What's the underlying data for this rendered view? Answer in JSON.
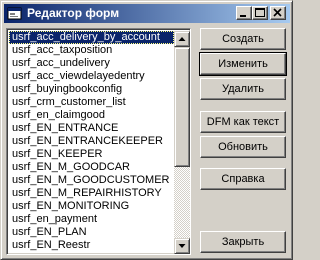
{
  "window": {
    "title": "Редактор форм"
  },
  "list": {
    "items": [
      "usrf_acc_delivery_by_account",
      "usrf_acc_taxposition",
      "usrf_acc_undelivery",
      "usrf_acc_viewdelayedentry",
      "usrf_buyingbookconfig",
      "usrf_crm_customer_list",
      "usrf_en_claimgood",
      "usrf_EN_ENTRANCE",
      "usrf_EN_ENTRANCEKEEPER",
      "usrf_EN_KEEPER",
      "usrf_EN_M_GOODCAR",
      "usrf_EN_M_GOODCUSTOMER",
      "usrf_EN_M_REPAIRHISTORY",
      "usrf_EN_MONITORING",
      "usrf_en_payment",
      "usrf_EN_PLAN",
      "usrf_EN_Reestr"
    ],
    "selected_index": 0
  },
  "buttons": {
    "create": "Создать",
    "edit": "Изменить",
    "delete": "Удалить",
    "dfm_text": "DFM как текст",
    "refresh": "Обновить",
    "help": "Справка",
    "close": "Закрыть"
  },
  "colors": {
    "title_start": "#0a246a",
    "title_end": "#a6caf0",
    "selection": "#0a246a",
    "face": "#d4d0c8"
  }
}
